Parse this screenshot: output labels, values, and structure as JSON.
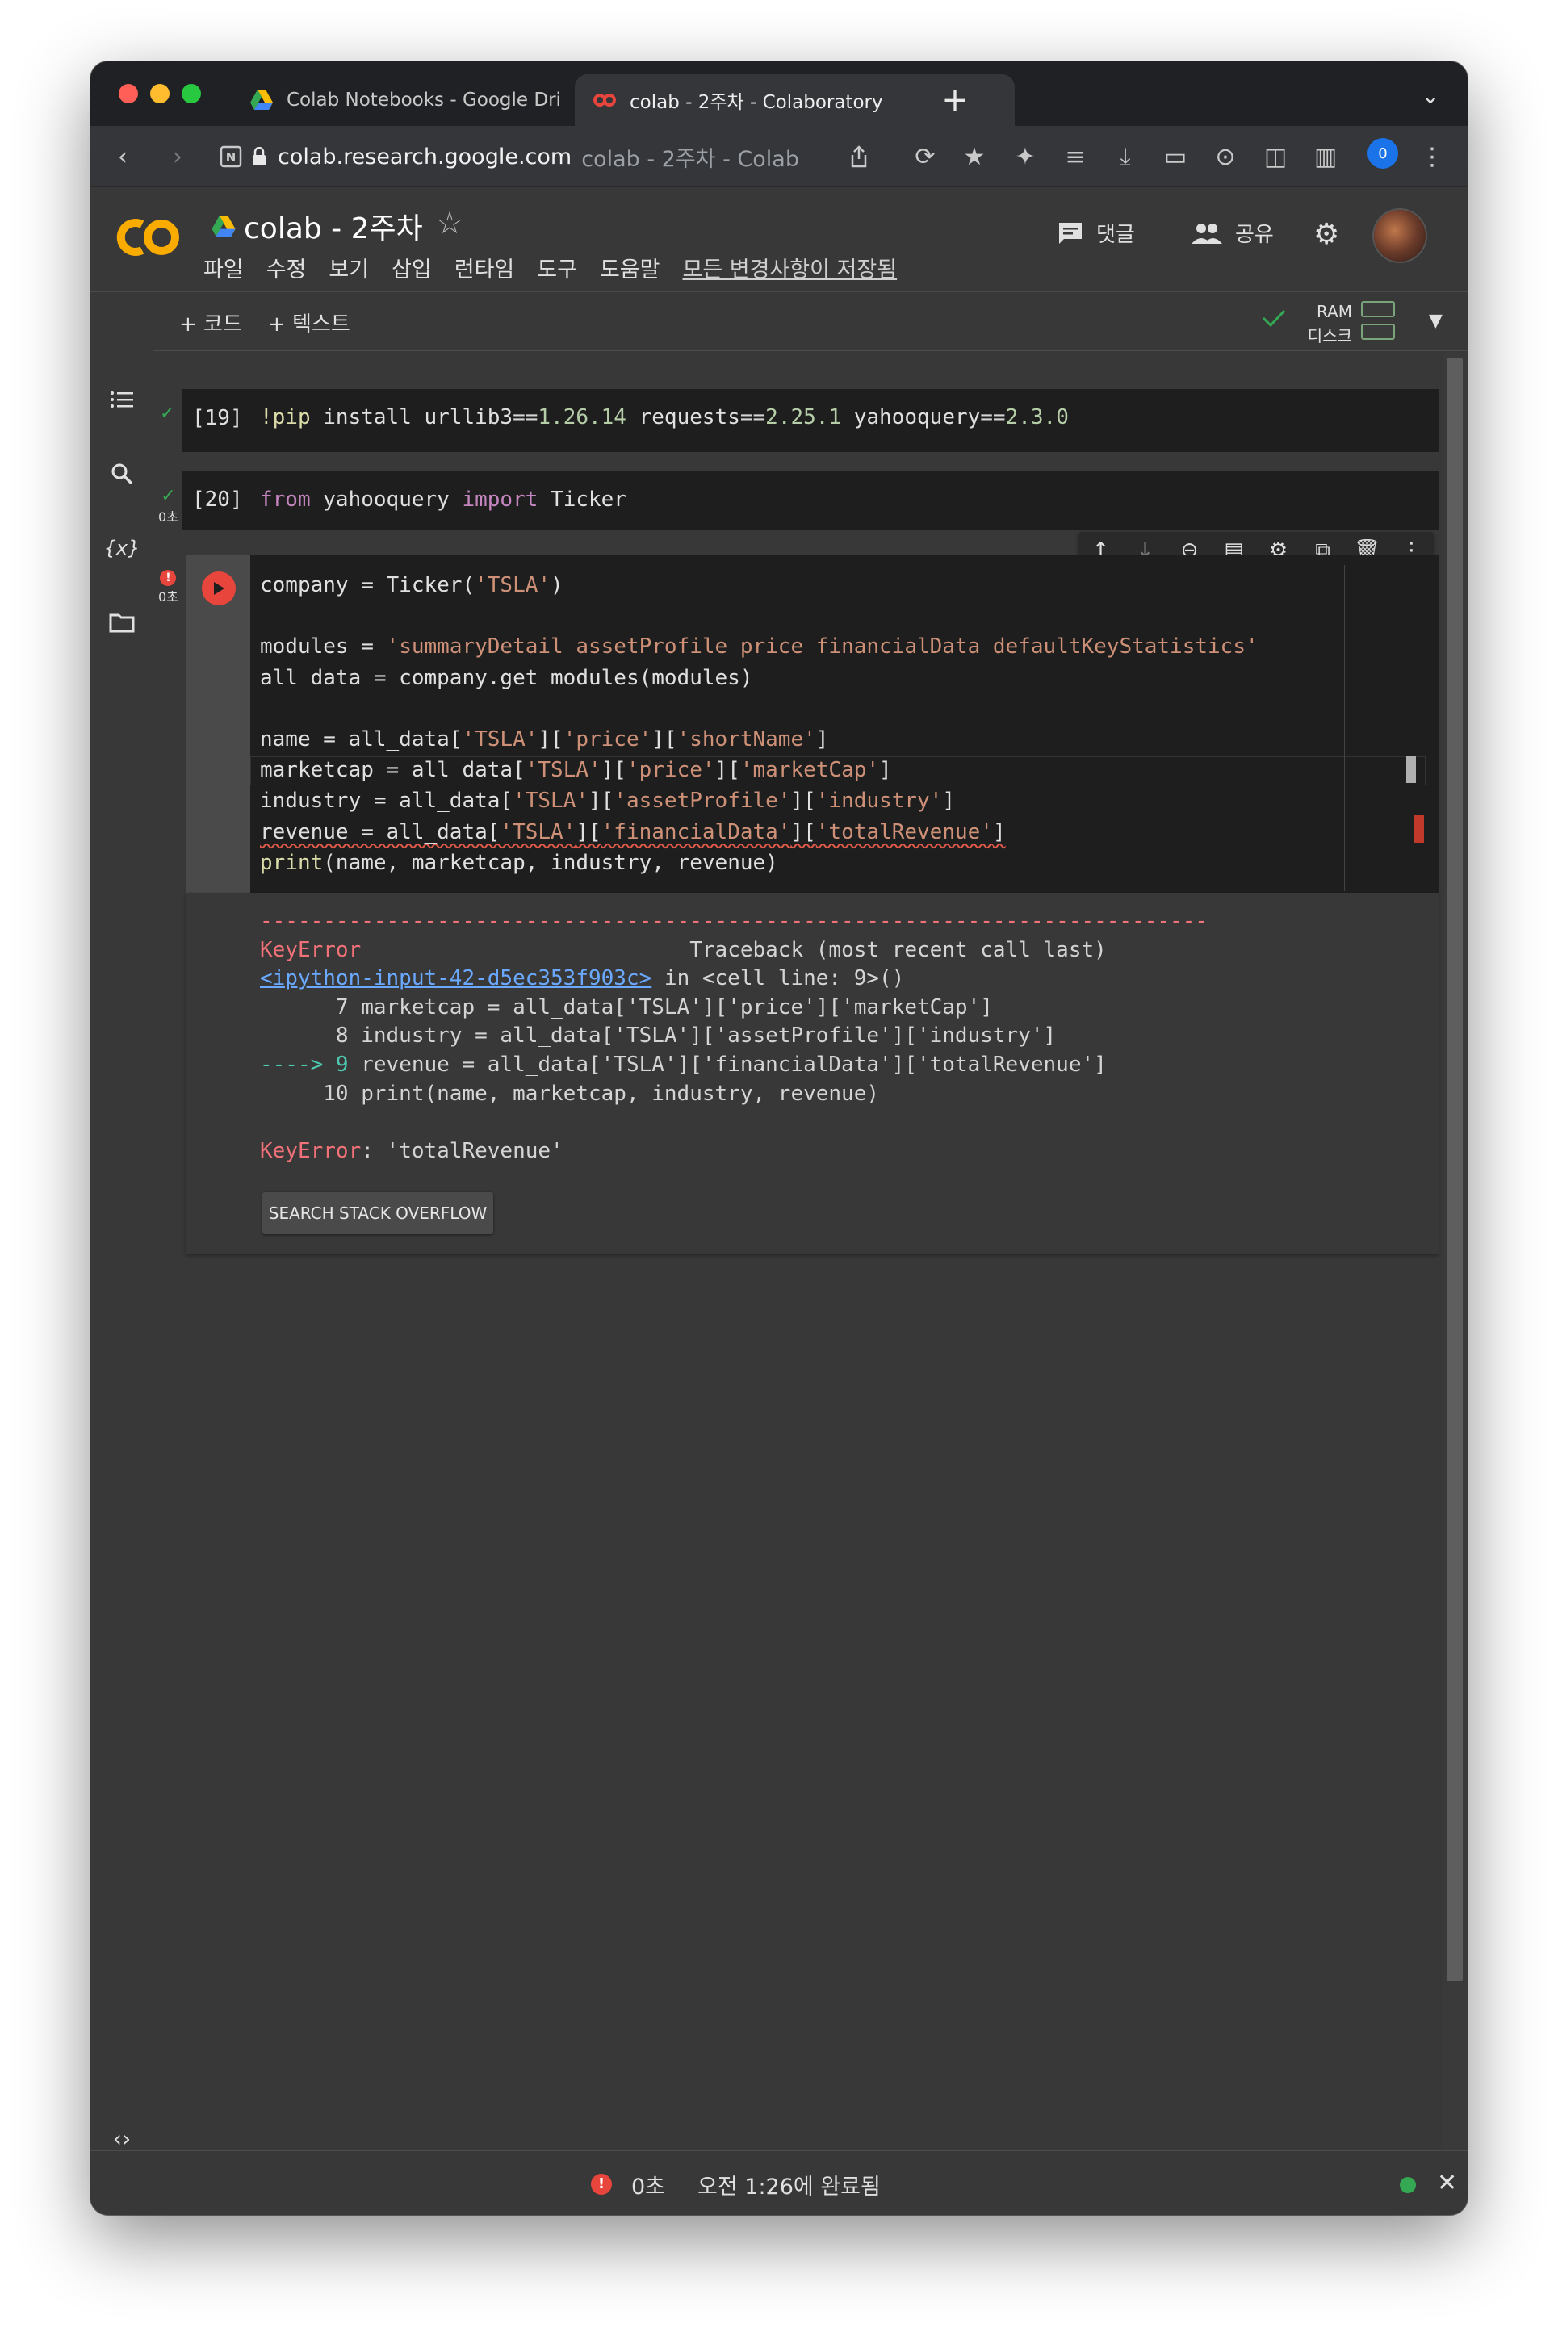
{
  "browser": {
    "tabs": [
      {
        "title": "Colab Notebooks - Google Dri",
        "active": false
      },
      {
        "title": "colab - 2주차 - Colaboratory",
        "active": true
      }
    ],
    "url_host": "colab.research.google.com",
    "url_tail": "colab - 2주차 - Colab",
    "profile_badge": "0"
  },
  "colab": {
    "logo": "CO",
    "notebook_title": "colab - 2주차",
    "menu": [
      "파일",
      "수정",
      "보기",
      "삽입",
      "런타임",
      "도구",
      "도움말"
    ],
    "saved_status": "모든 변경사항이 저장됨",
    "comment_label": "댓글",
    "share_label": "공유",
    "add_code": "+ 코드",
    "add_text": "+ 텍스트",
    "ram_label": "RAM",
    "disk_label": "디스크"
  },
  "cells": [
    {
      "prompt": "[19]",
      "status": "ok",
      "time": "",
      "code": "!pip install urllib3==1.26.14 requests==2.25.1 yahooquery==2.3.0"
    },
    {
      "prompt": "[20]",
      "status": "ok",
      "time": "0초",
      "code": "from yahooquery import Ticker"
    },
    {
      "prompt": "",
      "status": "error",
      "time": "0초"
    }
  ],
  "error_output": {
    "dashes": "---------------------------------------------------------------------------",
    "error_name": "KeyError",
    "traceback_header": "Traceback (most recent call last)",
    "input_link": "<ipython-input-42-d5ec353f903c>",
    "in_cell": " in <cell line: 9>()",
    "line7": "      7 marketcap = all_data['TSLA']['price']['marketCap']",
    "line8": "      8 industry = all_data['TSLA']['assetProfile']['industry']",
    "arrow": "----> 9",
    "line9": " revenue = all_data['TSLA']['financialData']['totalRevenue']",
    "line10": "     10 print(name, marketcap, industry, revenue)",
    "final_name": "KeyError",
    "final_msg": ": 'totalRevenue'",
    "so_button": "SEARCH STACK OVERFLOW"
  },
  "status_bar": {
    "time": "0초",
    "completed": "오전 1:26에 완료됨"
  },
  "colors": {
    "accent_orange": "#f9ab00",
    "error_red": "#e8453c",
    "ok_green": "#34a853"
  }
}
